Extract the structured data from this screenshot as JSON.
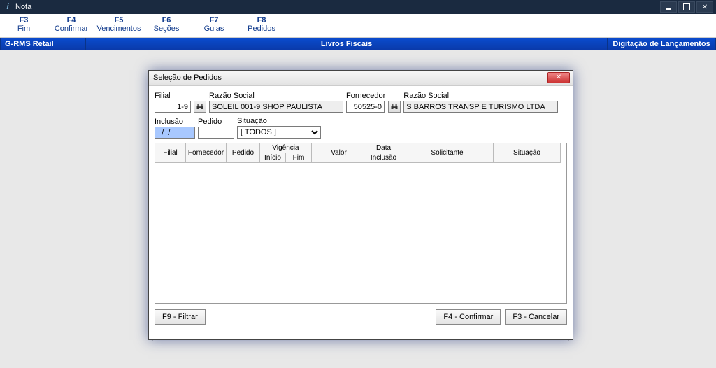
{
  "window": {
    "title": "Nota"
  },
  "fkeys": [
    {
      "key": "F3",
      "label": "Fim"
    },
    {
      "key": "F4",
      "label": "Confirmar"
    },
    {
      "key": "F5",
      "label": "Vencimentos"
    },
    {
      "key": "F6",
      "label": "Seções"
    },
    {
      "key": "F7",
      "label": "Guias"
    },
    {
      "key": "F8",
      "label": "Pedidos"
    }
  ],
  "banner": {
    "left": "G-RMS Retail",
    "center": "Livros Fiscais",
    "right": "Digitação de Lançamentos"
  },
  "dialog": {
    "title": "Seleção de Pedidos",
    "labels": {
      "filial": "Filial",
      "razao_social": "Razão Social",
      "fornecedor": "Fornecedor",
      "inclusao": "Inclusão",
      "pedido": "Pedido",
      "situacao": "Situação"
    },
    "values": {
      "filial": "1-9",
      "razao1": "SOLEIL 001-9 SHOP PAULISTA",
      "fornecedor": "50525-0",
      "razao2": "S BARROS TRANSP E TURISMO LTDA",
      "inclusao": "  /  /",
      "pedido": "",
      "situacao": "[ TODOS ]"
    },
    "table": {
      "headers": {
        "filial": "Filial",
        "fornecedor": "Fornecedor",
        "pedido": "Pedido",
        "vigencia": "Vigência",
        "vig_inicio": "Início",
        "vig_fim": "Fim",
        "valor": "Valor",
        "data": "Data",
        "data_sub": "Inclusão",
        "solicitante": "Solicitante",
        "situacao": "Situação"
      },
      "rows": []
    },
    "buttons": {
      "filtrar": "F9 - Filtrar",
      "confirmar": "F4 - Confirmar",
      "cancelar": "F3 - Cancelar"
    }
  }
}
